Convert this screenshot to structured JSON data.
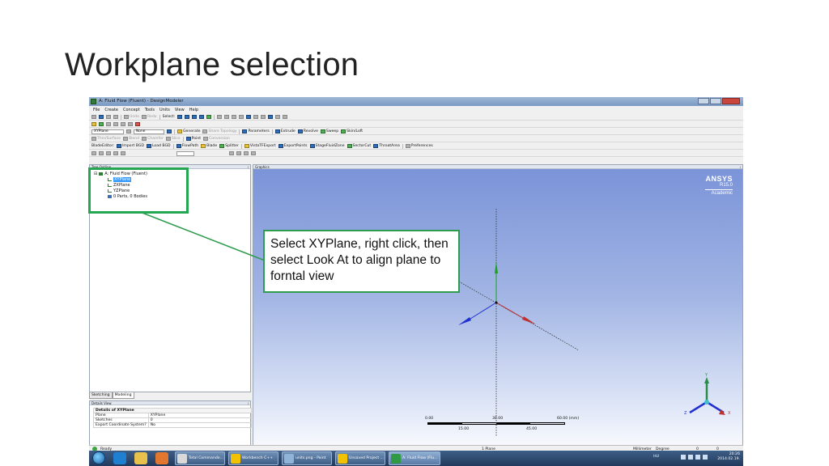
{
  "slide": {
    "title": "Workplane selection"
  },
  "window": {
    "title": "A: Fluid Flow (Fluent) - DesignModeler"
  },
  "menu": [
    "File",
    "Create",
    "Concept",
    "Tools",
    "Units",
    "View",
    "Help"
  ],
  "toolbar1": {
    "undo": "Undo",
    "redo": "Redo",
    "select": "Select:"
  },
  "toolbar3": {
    "plane_value": "XYPlane",
    "sketch_value": "None",
    "generate": "Generate",
    "share_topology": "Share Topology",
    "parameters": "Parameters",
    "extrude": "Extrude",
    "revolve": "Revolve",
    "sweep": "Sweep",
    "skin_loft": "Skin/Loft"
  },
  "toolbar4": {
    "thin_surface": "Thin/Surface",
    "blend": "Blend",
    "chamfer": "Chamfer",
    "slice": "Slice",
    "point": "Point",
    "conversion": "Conversion"
  },
  "toolbar5": {
    "blade_editor": "BladeEditor:",
    "import_bgd": "Import BGD",
    "load_bgd": "Load BGD",
    "flowpath": "FlowPath",
    "blade": "Blade",
    "splitter": "Splitter",
    "vista_tf_export": "VistaTFExport",
    "export_points": "ExportPoints",
    "stage_fluid_zone": "StageFluidZone",
    "sector_cut": "SectorCut",
    "throat_area": "ThroatArea",
    "preferences": "Preferences"
  },
  "tree": {
    "header": "Tree Outline",
    "root": "A: Fluid Flow (Fluent)",
    "items": [
      "XYPlane",
      "ZXPlane",
      "YZPlane",
      "0 Parts, 0 Bodies"
    ],
    "selected_index": 0
  },
  "tabs": {
    "sketching": "Sketching",
    "modeling": "Modeling",
    "active": "Modeling"
  },
  "details": {
    "header": "Details View",
    "group": "Details of XYPlane",
    "rows": [
      {
        "key": "Plane",
        "value": "XYPlane"
      },
      {
        "key": "Sketches",
        "value": "0"
      },
      {
        "key": "Export Coordinate System?",
        "value": "No"
      }
    ]
  },
  "graphics": {
    "header": "Graphics",
    "logo": {
      "brand": "ANSYS",
      "version": "R15.0",
      "edition": "Academic"
    },
    "scale": {
      "top_labels": [
        "0.00",
        "30.00",
        "60.00 (mm)"
      ],
      "bottom_labels": [
        "15.00",
        "45.00"
      ]
    },
    "tabs": {
      "model_view": "Model View",
      "print_preview": "Print Preview"
    }
  },
  "status": {
    "ready": "Ready",
    "selection": "1 Plane",
    "units": "Millimeter",
    "angle": "Degree",
    "v1": "0",
    "v2": "0"
  },
  "taskbar": {
    "items": [
      "Total Commande...",
      "Workbench C++",
      "units.png - Paint",
      "Unsaved Project ...",
      "A: Fluid Flow (Flu..."
    ],
    "lang": "HU",
    "time": "20:26",
    "date": "2014.02.19."
  },
  "callout": {
    "text": "Select XYPlane, right click, then select Look At to align plane to forntal view"
  },
  "colors": {
    "highlight": "#26a552",
    "graphics_top": "#7a93d8",
    "selection": "#3399ff",
    "axis_x": "#c03030",
    "axis_y": "#20a020",
    "axis_z": "#2030d0"
  },
  "triad_labels": {
    "x": "X",
    "y": "Y",
    "z": "Z"
  }
}
